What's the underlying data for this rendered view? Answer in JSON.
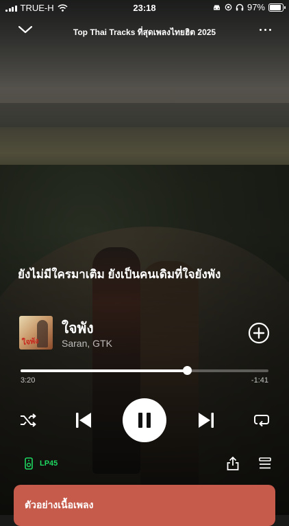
{
  "status_bar": {
    "carrier": "TRUE-H",
    "time": "23:18",
    "battery": "97%"
  },
  "header": {
    "playlist_title": "Top Thai Tracks ที่สุดเพลงไทยฮิต 2025"
  },
  "lyrics": {
    "current_line": "ยังไม่มีใครมาเติม ยังเป็นคนเดิมที่ใจยังพัง"
  },
  "track": {
    "album_art_text": "ใจพัง",
    "title": "ใจพัง",
    "artist": "Saran, GTK"
  },
  "playback": {
    "elapsed": "3:20",
    "remaining": "-1:41",
    "progress_fraction": 0.67
  },
  "device": {
    "name": "LP45"
  },
  "lyrics_card": {
    "label": "ตัวอย่างเนื้อเพลง",
    "color": "#c65b4c"
  },
  "icons": [
    "chevron-down-icon",
    "more-icon",
    "add-icon",
    "shuffle-icon",
    "previous-icon",
    "pause-icon",
    "next-icon",
    "repeat-icon",
    "speaker-icon",
    "share-icon",
    "queue-icon"
  ]
}
